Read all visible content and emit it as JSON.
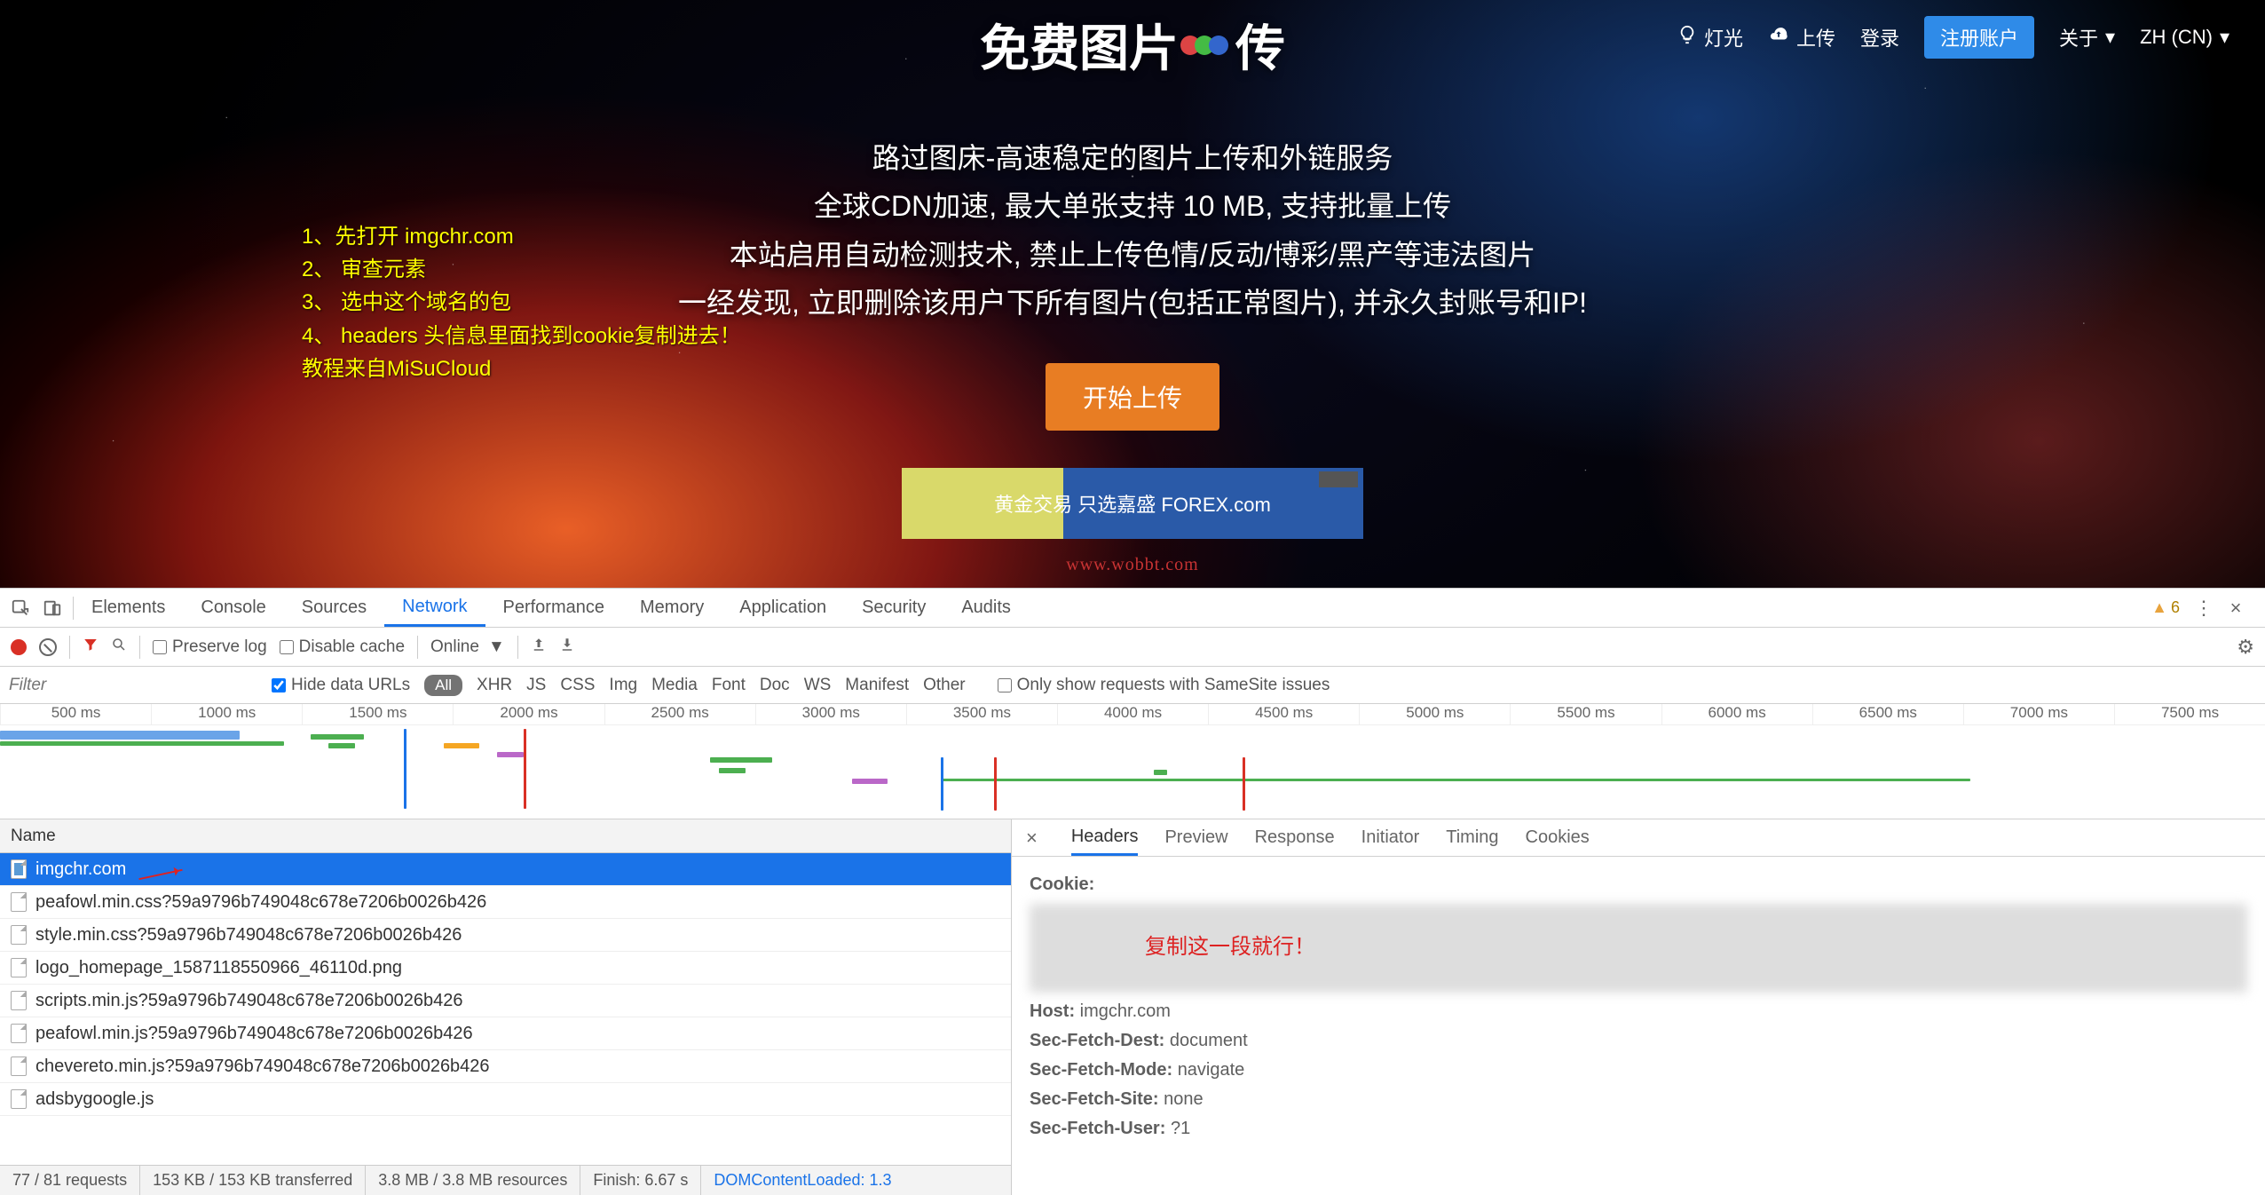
{
  "site": {
    "title_pre": "免费图片",
    "title_post": "传",
    "subtitle_1": "路过图床-高速稳定的图片上传和外链服务",
    "subtitle_2": "全球CDN加速, 最大单张支持 10 MB, 支持批量上传",
    "subtitle_3": "本站启用自动检测技术, 禁止上传色情/反动/博彩/黑产等违法图片",
    "subtitle_4": "一经发现, 立即删除该用户下所有图片(包括正常图片), 并永久封账号和IP!",
    "cta": "开始上传",
    "nav": {
      "light": "灯光",
      "upload": "上传",
      "login": "登录",
      "register": "注册账户",
      "about": "关于",
      "lang": "ZH (CN)"
    },
    "ad_text": "黄金交易 只选嘉盛   FOREX.com",
    "watermark": "www.wobbt.com"
  },
  "overlay": {
    "l1": "1、先打开 imgchr.com",
    "l2": "2、 审查元素",
    "l3": "3、 选中这个域名的包",
    "l4": "4、 headers 头信息里面找到cookie复制进去！",
    "l5": "教程来自MiSuCloud"
  },
  "devtools": {
    "tabs": {
      "elements": "Elements",
      "console": "Console",
      "sources": "Sources",
      "network": "Network",
      "performance": "Performance",
      "memory": "Memory",
      "application": "Application",
      "security": "Security",
      "audits": "Audits"
    },
    "warn_count": "6",
    "toolbar": {
      "preserve": "Preserve log",
      "disable": "Disable cache",
      "online": "Online"
    },
    "filter": {
      "placeholder": "Filter",
      "hide": "Hide data URLs",
      "all": "All",
      "types": [
        "XHR",
        "JS",
        "CSS",
        "Img",
        "Media",
        "Font",
        "Doc",
        "WS",
        "Manifest",
        "Other"
      ],
      "samesite": "Only show requests with SameSite issues"
    },
    "timeline_ticks": [
      "500 ms",
      "1000 ms",
      "1500 ms",
      "2000 ms",
      "2500 ms",
      "3000 ms",
      "3500 ms",
      "4000 ms",
      "4500 ms",
      "5000 ms",
      "5500 ms",
      "6000 ms",
      "6500 ms",
      "7000 ms",
      "7500 ms"
    ],
    "name_hdr": "Name",
    "requests": [
      "imgchr.com",
      "peafowl.min.css?59a9796b749048c678e7206b0026b426",
      "style.min.css?59a9796b749048c678e7206b0026b426",
      "logo_homepage_1587118550966_46110d.png",
      "scripts.min.js?59a9796b749048c678e7206b0026b426",
      "peafowl.min.js?59a9796b749048c678e7206b0026b426",
      "chevereto.min.js?59a9796b749048c678e7206b0026b426",
      "adsbygoogle.js"
    ],
    "status": {
      "req": "77 / 81 requests",
      "xfer": "153 KB / 153 KB transferred",
      "res": "3.8 MB / 3.8 MB resources",
      "finish": "Finish: 6.67 s",
      "dcl": "DOMContentLoaded: 1.3"
    },
    "detail_tabs": {
      "headers": "Headers",
      "preview": "Preview",
      "response": "Response",
      "initiator": "Initiator",
      "timing": "Timing",
      "cookies": "Cookies"
    },
    "headers": {
      "cookie_k": "Cookie:",
      "copy_hint": "复制这一段就行！",
      "host_k": "Host:",
      "host_v": "imgchr.com",
      "sfd_k": "Sec-Fetch-Dest:",
      "sfd_v": "document",
      "sfm_k": "Sec-Fetch-Mode:",
      "sfm_v": "navigate",
      "sfs_k": "Sec-Fetch-Site:",
      "sfs_v": "none",
      "sfu_k": "Sec-Fetch-User:",
      "sfu_v": "?1"
    }
  }
}
